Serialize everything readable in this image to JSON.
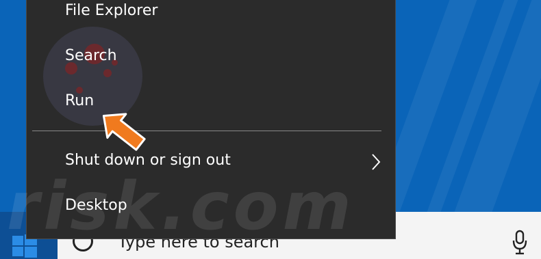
{
  "context_menu": {
    "items": [
      {
        "label": "File Explorer",
        "has_submenu": false
      },
      {
        "label": "Search",
        "has_submenu": false
      },
      {
        "label": "Run",
        "has_submenu": false
      },
      {
        "label": "Shut down or sign out",
        "has_submenu": true
      },
      {
        "label": "Desktop",
        "has_submenu": false
      }
    ],
    "pointed_item": "Run"
  },
  "taskbar": {
    "search_placeholder": "Type here to search",
    "icons": [
      "windows-logo-icon",
      "search-icon",
      "microphone-icon"
    ]
  },
  "watermark": {
    "text": "risk.com"
  },
  "colors": {
    "desktop": "#0a64b8",
    "menu_background": "#2b2b2b",
    "menu_text": "#ffffff",
    "taskbar": "#0d4f95",
    "search_box": "#f4f4f4",
    "pointer_arrow": "#f07a1e"
  }
}
